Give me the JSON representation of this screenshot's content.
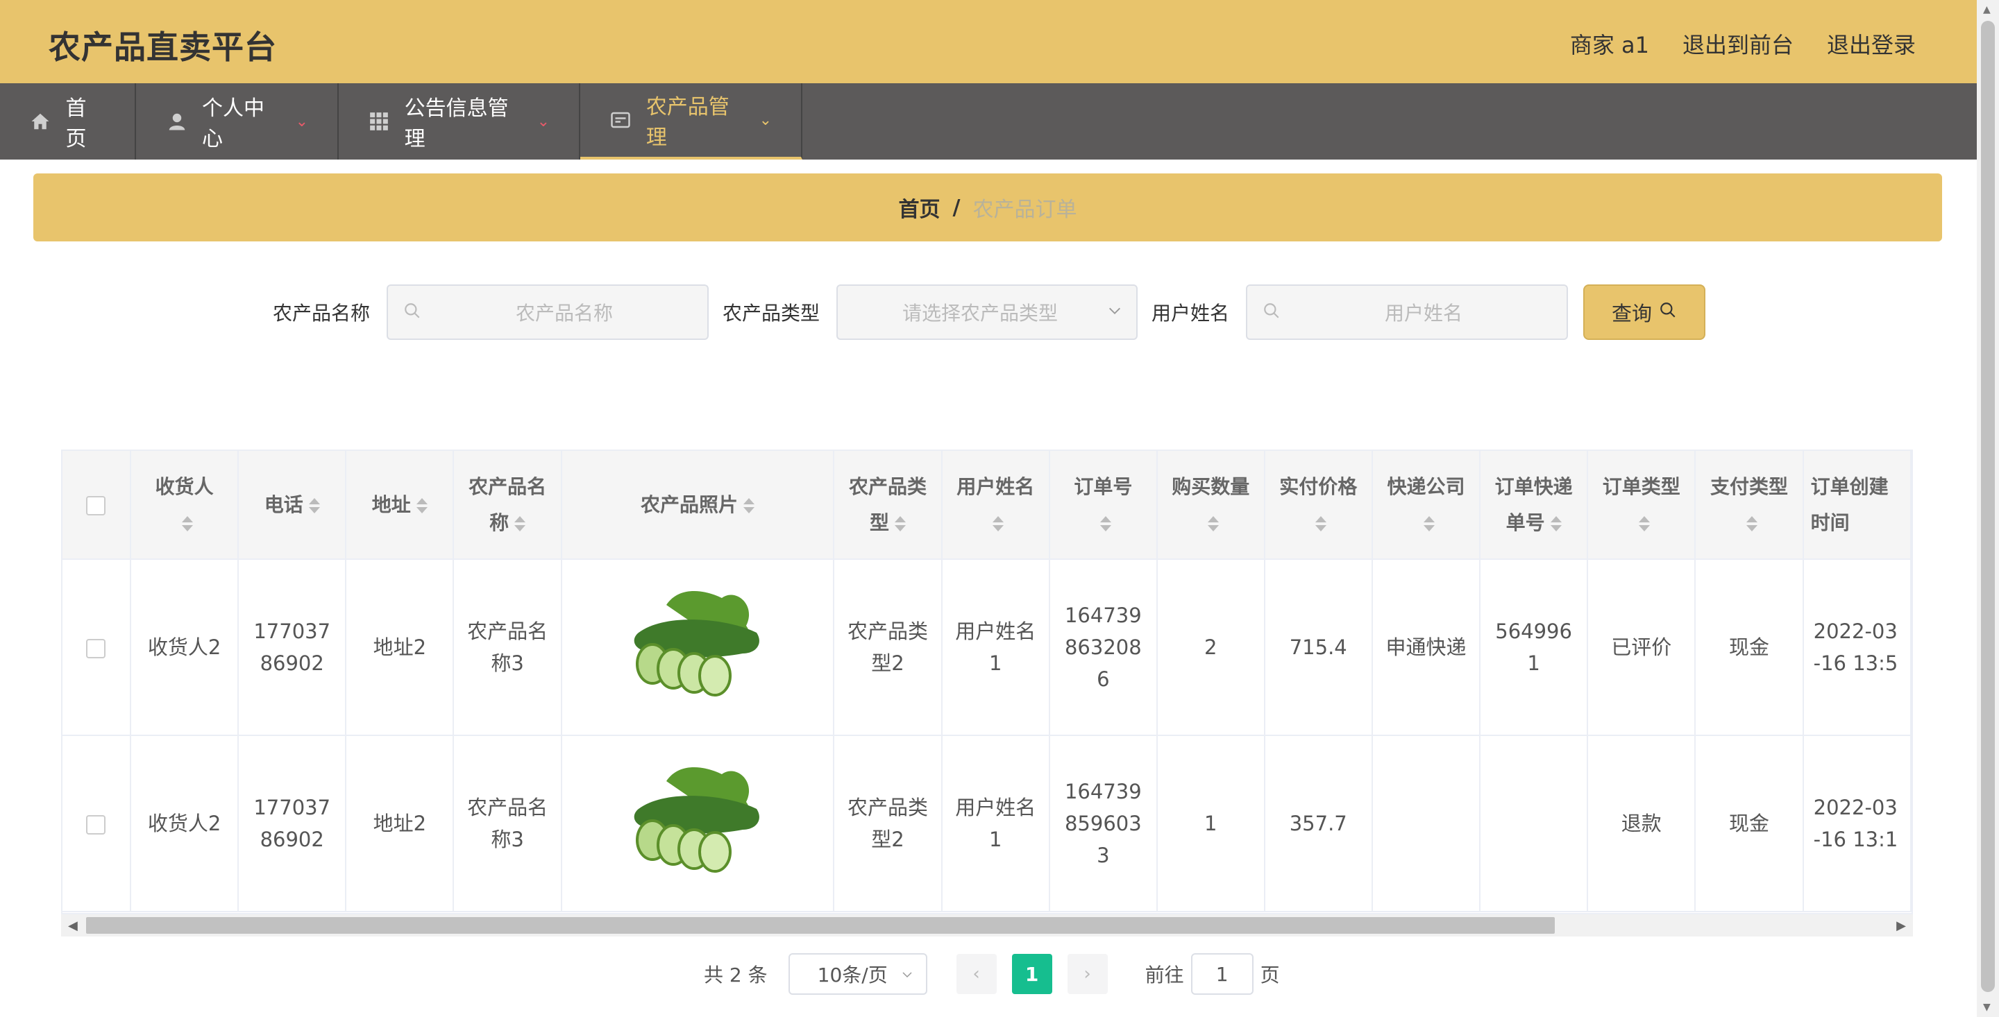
{
  "header": {
    "brand": "农产品直卖平台",
    "user": "商家 a1",
    "to_front": "退出到前台",
    "logout": "退出登录"
  },
  "nav": {
    "items": [
      {
        "label": "首页",
        "icon": "home-icon"
      },
      {
        "label": "个人中心",
        "icon": "user-icon"
      },
      {
        "label": "公告信息管理",
        "icon": "grid-icon"
      },
      {
        "label": "农产品管理",
        "icon": "card-icon"
      }
    ]
  },
  "breadcrumb": {
    "home": "首页",
    "sep": "/",
    "current": "农产品订单"
  },
  "search": {
    "name_label": "农产品名称",
    "name_placeholder": "农产品名称",
    "type_label": "农产品类型",
    "type_placeholder": "请选择农产品类型",
    "user_label": "用户姓名",
    "user_placeholder": "用户姓名",
    "button": "查询"
  },
  "table": {
    "headers": [
      "收货人",
      "电话",
      "地址",
      "农产品名称",
      "农产品照片",
      "农产品类型",
      "用户姓名",
      "订单号",
      "购买数量",
      "实付价格",
      "快递公司",
      "订单快递单号",
      "订单类型",
      "支付类型",
      "订单创建时间"
    ],
    "rows": [
      [
        "收货人2",
        "17703786902",
        "地址2",
        "农产品名称3",
        "",
        "农产品类型2",
        "用户姓名1",
        "1647398632086",
        "2",
        "715.4",
        "申通快递",
        "5649961",
        "已评价",
        "现金",
        "2022-03-16 13:5"
      ],
      [
        "收货人2",
        "17703786902",
        "地址2",
        "农产品名称3",
        "",
        "农产品类型2",
        "用户姓名1",
        "1647398596033",
        "1",
        "357.7",
        "",
        "",
        "退款",
        "现金",
        "2022-03-16 13:1"
      ]
    ]
  },
  "pager": {
    "total": "共 2 条",
    "size": "10条/页",
    "page": "1",
    "goto_prefix": "前往",
    "goto_value": "1",
    "goto_suffix": "页"
  },
  "colors": {
    "accent": "#e8c46c",
    "nav_bg": "#5c5a5a",
    "page_active": "#16be8f"
  }
}
